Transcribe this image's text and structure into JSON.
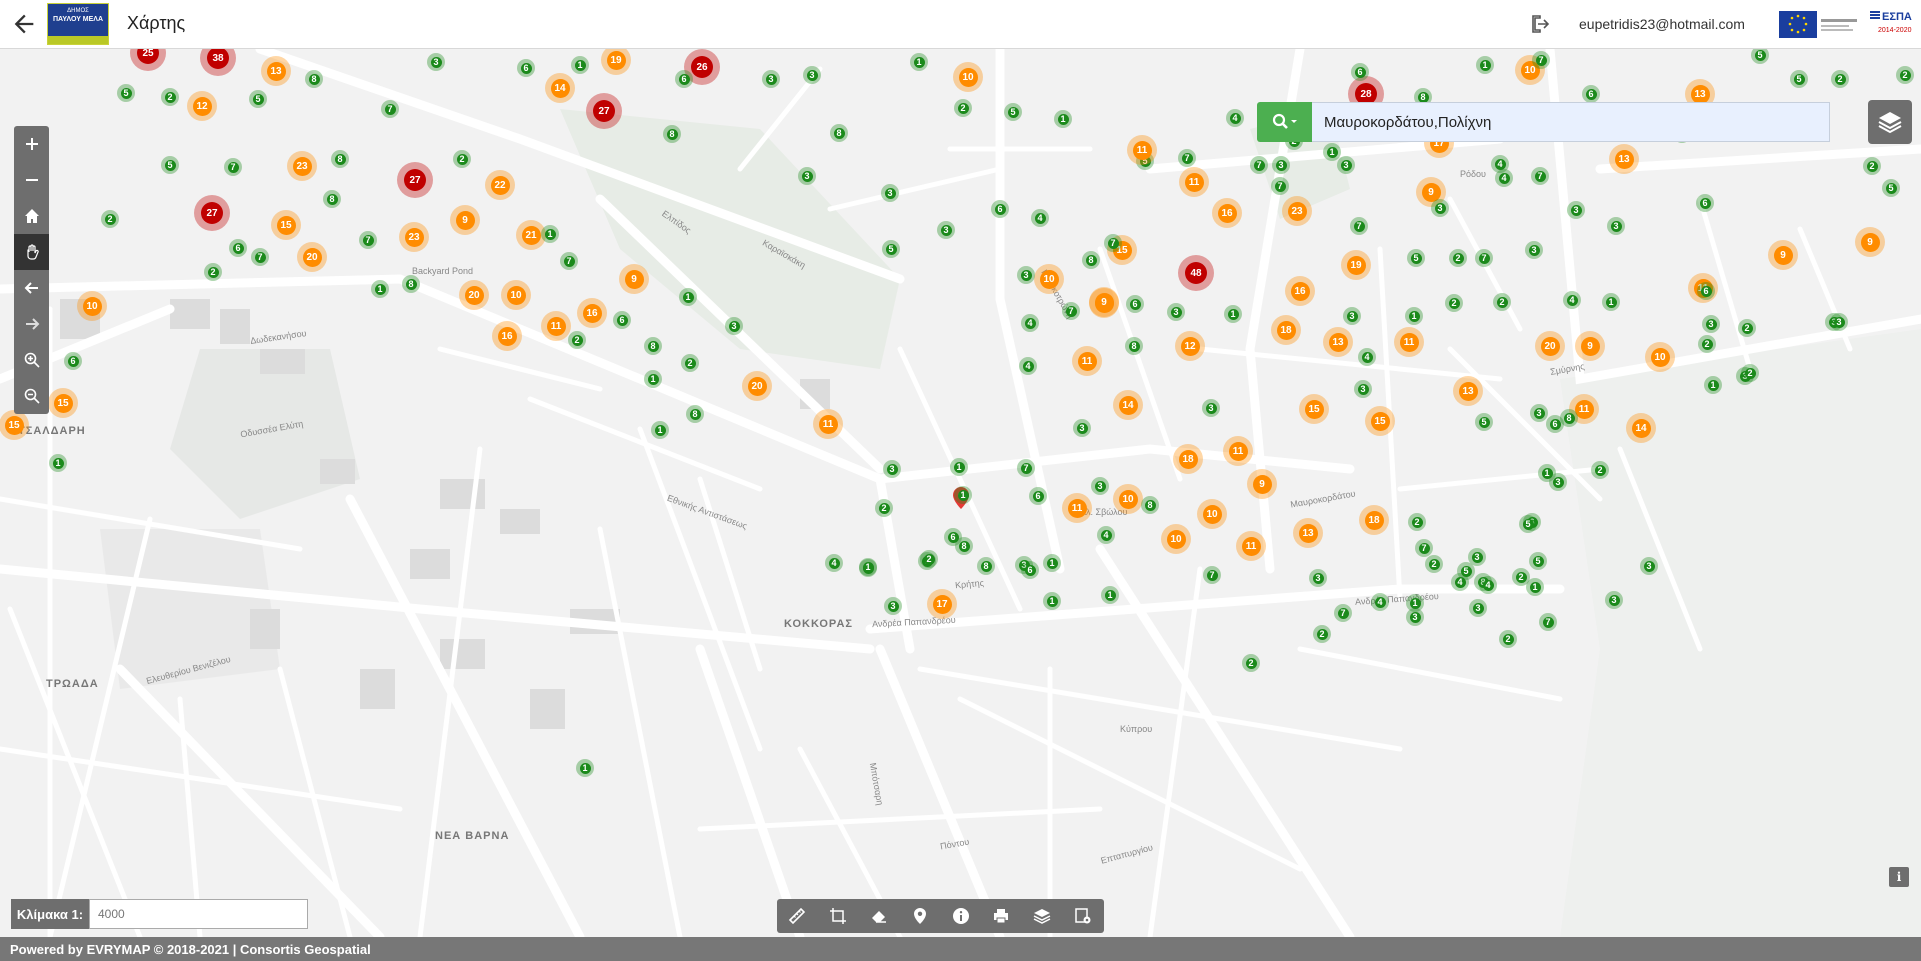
{
  "header": {
    "title": "Χάρτης",
    "logo_line1": "ΔΗΜΟΣ",
    "logo_line2": "ΠΑΥΛΟΥ ΜΕΛΑ",
    "user_email": "eupetridis23@hotmail.com",
    "espa_label": "ΕΣΠΑ",
    "espa_years": "2014-2020"
  },
  "icons": {
    "back": "arrow-left-icon",
    "logout": "logout-icon",
    "search": "search-icon",
    "layers": "layers-icon",
    "info": "info-icon"
  },
  "left_toolbar": [
    {
      "name": "zoom-in",
      "glyph": "+"
    },
    {
      "name": "zoom-out",
      "glyph": "−"
    },
    {
      "name": "home",
      "glyph": "⌂"
    },
    {
      "name": "pan",
      "glyph": "✋",
      "active": true
    },
    {
      "name": "previous-extent",
      "glyph": "←"
    },
    {
      "name": "next-extent",
      "glyph": "→"
    },
    {
      "name": "zoom-box-in",
      "glyph": "⊕"
    },
    {
      "name": "zoom-box-out",
      "glyph": "⊖"
    }
  ],
  "search": {
    "value": "Μαυροκορδάτου,Πολίχνη"
  },
  "scale": {
    "label": "Κλίμακα 1:",
    "value": "4000"
  },
  "bottom_tools": [
    "measure-icon",
    "area-icon",
    "eraser-icon",
    "map-pin-icon",
    "info-icon",
    "print-icon",
    "layers-icon",
    "settings-icon"
  ],
  "footer": {
    "text": "Powered by EVRYMAP © 2018-2021 | Consortis Geospatial"
  },
  "map": {
    "district_labels": [
      "ΚΟΚΚΟΡΑΣ",
      "ΤΡΩΑΔΑ",
      "ΝΕΑ ΒΑΡΝΑ",
      "ΤΣΑΛΔΑΡΗ"
    ],
    "street_labels": [
      "Ανδρέα Παπανδρέου",
      "Ελπίδος",
      "Backyard Pond",
      "Δωδεκανήσου",
      "Ελευθερίου Βενιζέλου",
      "Μαυροκορδάτου",
      "Οδυσσέα Ελύτη",
      "Εθνικής Αντιστάσεως",
      "Αλ. Σβώλου",
      "Κρήτης",
      "Καραϊσκάκη",
      "Κολοκοτρώνη",
      "Επταπυργίου",
      "Κύπρου",
      "Μπότσαρη",
      "Ρόδου",
      "Σμύρνης",
      "Πόντου"
    ],
    "colors": {
      "green": "#1b8a1b",
      "orange": "#ff8c00",
      "red": "#c00000"
    }
  }
}
